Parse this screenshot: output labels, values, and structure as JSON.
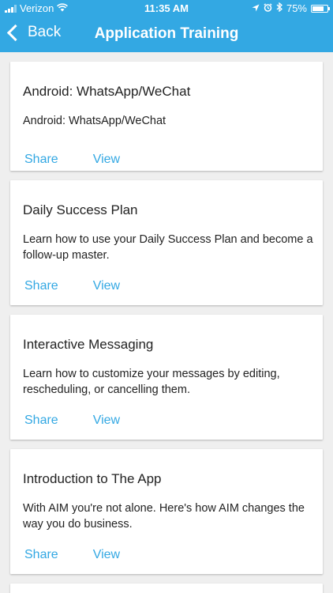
{
  "status_bar": {
    "carrier": "Verizon",
    "time": "11:35 AM",
    "battery": "75%",
    "battery_level": 0.75
  },
  "nav": {
    "back_label": "Back",
    "title": "Application Training"
  },
  "colors": {
    "accent": "#33a8e3",
    "background": "#efefef",
    "card": "#ffffff"
  },
  "cards": [
    {
      "title": "Android: WhatsApp/WeChat",
      "description": "Android: WhatsApp/WeChat",
      "share_label": "Share",
      "view_label": "View"
    },
    {
      "title": "Daily Success Plan",
      "description": "Learn how to use your Daily Success Plan and become a follow-up master.",
      "share_label": "Share",
      "view_label": "View"
    },
    {
      "title": "Interactive Messaging",
      "description": "Learn how to customize your messages by editing, rescheduling, or cancelling them.",
      "share_label": "Share",
      "view_label": "View"
    },
    {
      "title": "Introduction to The App",
      "description": "With AIM you're not alone. Here's how AIM changes the way you do business.",
      "share_label": "Share",
      "view_label": "View"
    }
  ]
}
